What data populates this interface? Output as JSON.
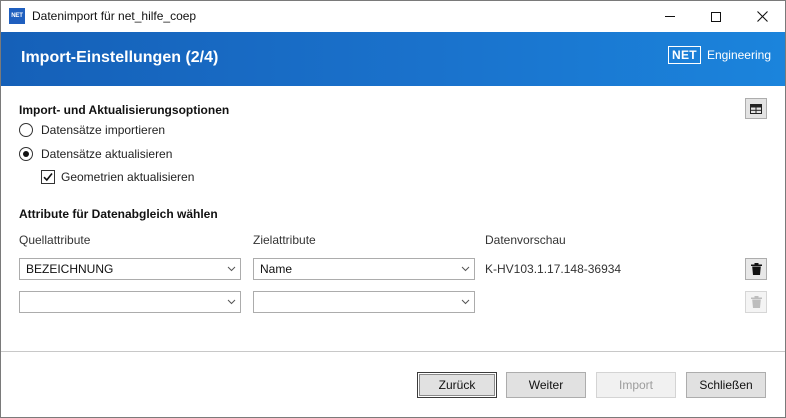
{
  "window": {
    "app_icon_text": "NET",
    "title": "Datenimport für net_hilfe_coep"
  },
  "banner": {
    "title": "Import-Einstellungen (2/4)",
    "brand_logo": "NET",
    "brand_text": "Engineering"
  },
  "options": {
    "title": "Import- und Aktualisierungsoptionen",
    "radio_import_label": "Datensätze importieren",
    "radio_update_label": "Datensätze aktualisieren",
    "selected": "update",
    "checkbox_geometry_label": "Geometrien aktualisieren",
    "checkbox_geometry_checked": true
  },
  "attributes": {
    "title": "Attribute für Datenabgleich wählen",
    "col_source": "Quellattribute",
    "col_target": "Zielattribute",
    "col_preview": "Datenvorschau",
    "rows": [
      {
        "source": "BEZEICHNUNG",
        "target": "Name",
        "preview": "K-HV103.1.17.148-36934"
      },
      {
        "source": "",
        "target": "",
        "preview": ""
      }
    ]
  },
  "footer": {
    "back_label": "Zurück",
    "next_label": "Weiter",
    "import_label": "Import",
    "close_label": "Schließen"
  },
  "colors": {
    "banner_start": "#1560b8",
    "banner_end": "#1b84dc"
  }
}
